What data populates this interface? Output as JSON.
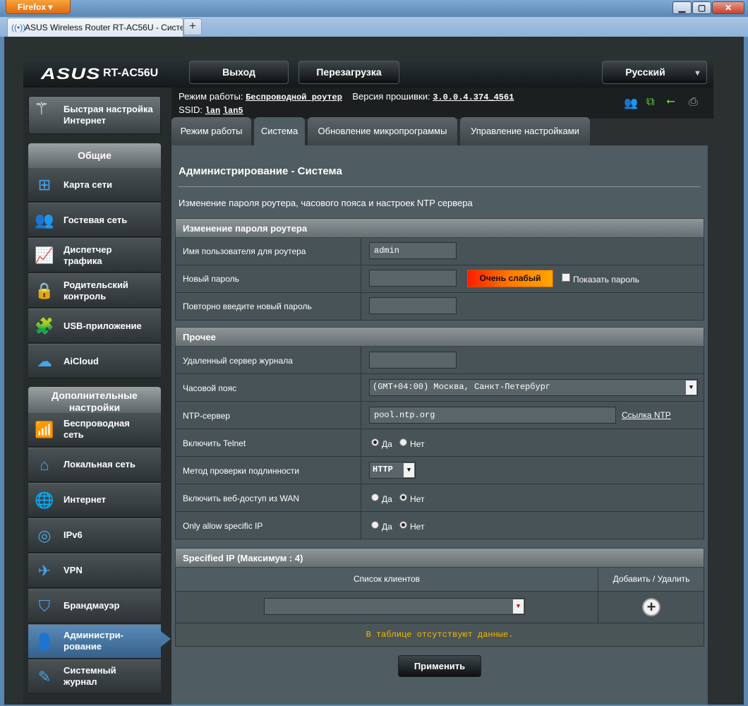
{
  "browser": {
    "app_button": "Firefox",
    "tab_title": "ASUS Wireless Router RT-AC56U - Систе...",
    "new_tab": "+",
    "win_min": "▁",
    "win_max": "▢",
    "win_close": "✕"
  },
  "header": {
    "logo": "ASUS",
    "model": "RT-AC56U",
    "logout": "Выход",
    "reboot": "Перезагрузка",
    "language": "Русский"
  },
  "info": {
    "mode_label": "Режим работы:",
    "mode_value": "Беспроводной роутер",
    "fw_label": "Версия прошивки:",
    "fw_value": "3.0.0.4.374_4561",
    "ssid_label": "SSID:",
    "ssid1": "lan",
    "ssid2": "lan5",
    "icons": [
      "clients-icon",
      "network-icon",
      "usb-icon",
      "printer-icon"
    ]
  },
  "tabs": [
    "Режим работы",
    "Система",
    "Обновление микропрограммы",
    "Управление настройками"
  ],
  "sidebar": {
    "quick_setup": "Быстрая настройка Интернет",
    "general": "Общие",
    "general_items": [
      "Карта сети",
      "Гостевая сеть",
      "Диспетчер трафика",
      "Родительский контроль",
      "USB-приложение",
      "AiCloud"
    ],
    "advanced": "Дополнительные настройки",
    "advanced_items": [
      "Беспроводная сеть",
      "Локальная сеть",
      "Интернет",
      "IPv6",
      "VPN",
      "Брандмауэр",
      "Администри-рование",
      "Системный журнал"
    ]
  },
  "page": {
    "title": "Администрирование - Система",
    "description": "Изменение пароля роутера, часового пояса и настроек NTP сервера"
  },
  "password": {
    "heading": "Изменение пароля роутера",
    "username_label": "Имя пользователя для роутера",
    "username_value": "admin",
    "newpass_label": "Новый пароль",
    "strength": "Очень слабый",
    "show_password": "Показать пароль",
    "repeat_label": "Повторно введите новый пароль"
  },
  "misc": {
    "heading": "Прочее",
    "log_server_label": "Удаленный сервер журнала",
    "timezone_label": "Часовой пояс",
    "timezone_value": "(GMT+04:00) Москва, Санкт-Петербург",
    "ntp_label": "NTP-сервер",
    "ntp_value": "pool.ntp.org",
    "ntp_link": "Ссылка NTP",
    "telnet_label": "Включить Telnet",
    "auth_label": "Метод проверки подлинности",
    "auth_value": "HTTP",
    "wan_label": "Включить веб-доступ из WAN",
    "specific_ip_label": "Only allow specific IP",
    "yes": "Да",
    "no": "Нет",
    "telnet": "yes",
    "wan": "no",
    "specific_ip": "no"
  },
  "specified_ip": {
    "heading": "Specified IP (Максимум : 4)",
    "col_clients": "Список клиентов",
    "col_action": "Добавить / Удалить",
    "empty": "В таблице отсутствуют данные."
  },
  "apply": "Применить"
}
